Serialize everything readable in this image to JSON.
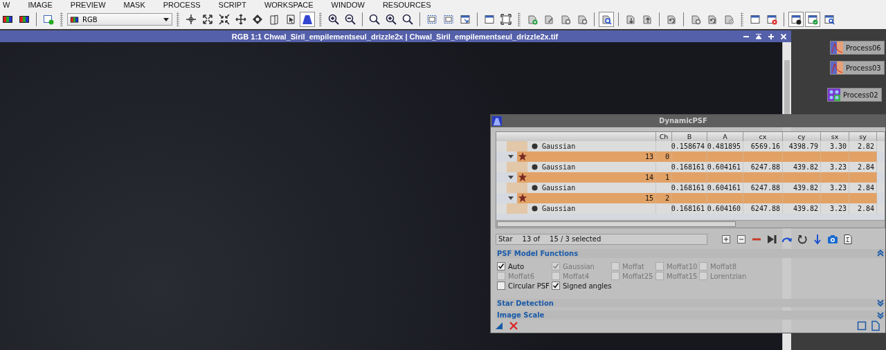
{
  "menu": [
    "W",
    "IMAGE",
    "PREVIEW",
    "MASK",
    "PROCESS",
    "SCRIPT",
    "WORKSPACE",
    "WINDOW",
    "RESOURCES"
  ],
  "toolbar": [
    {
      "kind": "channels",
      "selected": false
    },
    {
      "kind": "channels",
      "selected": false
    },
    {
      "kind": "separator"
    },
    {
      "kind": "new-window",
      "selected": false
    },
    {
      "kind": "grip"
    },
    {
      "kind": "combo",
      "value": "RGB"
    },
    {
      "kind": "grip"
    },
    {
      "kind": "crosshair",
      "selected": false
    },
    {
      "kind": "expand",
      "selected": false
    },
    {
      "kind": "shrink",
      "selected": false
    },
    {
      "kind": "move",
      "selected": false
    },
    {
      "kind": "diamond",
      "selected": false
    },
    {
      "kind": "page",
      "selected": false
    },
    {
      "kind": "page-pointer",
      "selected": false
    },
    {
      "kind": "curve",
      "selected": true
    },
    {
      "kind": "grip"
    },
    {
      "kind": "zoom-in",
      "selected": false
    },
    {
      "kind": "zoom-out",
      "selected": false
    },
    {
      "kind": "separator"
    },
    {
      "kind": "zoom",
      "selected": false
    },
    {
      "kind": "zoom-in",
      "selected": false
    },
    {
      "kind": "zoom",
      "selected": false
    },
    {
      "kind": "separator"
    },
    {
      "kind": "select",
      "selected": false
    },
    {
      "kind": "select",
      "selected": false
    },
    {
      "kind": "window-arrow",
      "selected": false
    },
    {
      "kind": "separator"
    },
    {
      "kind": "window",
      "selected": false
    },
    {
      "kind": "frame",
      "selected": false
    },
    {
      "kind": "grip"
    },
    {
      "kind": "doc-plus",
      "selected": false
    },
    {
      "kind": "doc-edit",
      "selected": false
    },
    {
      "kind": "doc-gear",
      "selected": false
    },
    {
      "kind": "doc-gear",
      "selected": false
    },
    {
      "kind": "separator"
    },
    {
      "kind": "doc-search",
      "selected": true
    },
    {
      "kind": "separator"
    },
    {
      "kind": "doc-down",
      "selected": false
    },
    {
      "kind": "doc-up",
      "selected": false
    },
    {
      "kind": "separator"
    },
    {
      "kind": "doc-undo",
      "selected": false
    },
    {
      "kind": "separator"
    },
    {
      "kind": "doc-gear",
      "selected": false
    },
    {
      "kind": "doc-undo",
      "selected": false
    },
    {
      "kind": "doc-cross",
      "selected": false
    },
    {
      "kind": "grip"
    },
    {
      "kind": "window",
      "selected": false
    },
    {
      "kind": "window-close",
      "selected": false
    },
    {
      "kind": "separator"
    },
    {
      "kind": "window-dark",
      "selected": true
    },
    {
      "kind": "window-check",
      "selected": true
    },
    {
      "kind": "window-search",
      "selected": false
    }
  ],
  "image_window": {
    "title": "RGB 1:1 Chwal_Siril_empilementseul_drizzle2x | Chwal_Siril_empilementseul_drizzle2x.tif"
  },
  "process_icons": [
    {
      "label": "Process06",
      "kind": "chart"
    },
    {
      "label": "Process03",
      "kind": "chart"
    },
    {
      "label": "Process02",
      "kind": "dots"
    }
  ],
  "dynamic_psf": {
    "title": "DynamicPSF",
    "columns": [
      "Ch",
      "B",
      "A",
      "cx",
      "cy",
      "sx",
      "sy"
    ],
    "rows": [
      {
        "kind": "function",
        "name": "Gaussian",
        "values": [
          "0.158674",
          "0.481895",
          "6569.16",
          "4398.79",
          "3.30",
          "2.82"
        ]
      },
      {
        "kind": "star",
        "number": "13",
        "channel": "0",
        "expanded": true,
        "selected": true
      },
      {
        "kind": "function",
        "name": "Gaussian",
        "values": [
          "0.168161",
          "0.604161",
          "6247.88",
          "439.82",
          "3.23",
          "2.84"
        ]
      },
      {
        "kind": "star",
        "number": "14",
        "channel": "1",
        "expanded": true,
        "selected": true
      },
      {
        "kind": "function",
        "name": "Gaussian",
        "values": [
          "0.168161",
          "0.604161",
          "6247.88",
          "439.82",
          "3.23",
          "2.84"
        ]
      },
      {
        "kind": "star",
        "number": "15",
        "channel": "2",
        "expanded": true,
        "selected": true
      },
      {
        "kind": "function",
        "name": "Gaussian",
        "values": [
          "0.168161",
          "0.604160",
          "6247.88",
          "439.82",
          "3.23",
          "2.84"
        ]
      }
    ],
    "status": {
      "label": "Star",
      "current": "13 of",
      "total": "15 / 3 selected"
    },
    "actions": [
      {
        "kind": "expand-all"
      },
      {
        "kind": "collapse-all"
      },
      {
        "kind": "remove"
      },
      {
        "kind": "last"
      },
      {
        "kind": "redo"
      },
      {
        "kind": "reset"
      },
      {
        "kind": "sort"
      },
      {
        "kind": "camera"
      },
      {
        "kind": "sum-doc"
      }
    ],
    "sections": [
      {
        "title": "PSF Model Functions",
        "expanded": true,
        "checkboxes": [
          {
            "label": "Auto",
            "checked": true,
            "disabled": false
          },
          {
            "label": "Gaussian",
            "checked": true,
            "disabled": true
          },
          {
            "label": "Moffat",
            "checked": false,
            "disabled": true
          },
          {
            "label": "Moffat10",
            "checked": false,
            "disabled": true
          },
          {
            "label": "Moffat8",
            "checked": false,
            "disabled": true
          },
          {
            "label": "Moffat6",
            "checked": false,
            "disabled": true
          },
          {
            "label": "Moffat4",
            "checked": false,
            "disabled": true
          },
          {
            "label": "Moffat25",
            "checked": false,
            "disabled": true
          },
          {
            "label": "Moffat15",
            "checked": false,
            "disabled": true
          },
          {
            "label": "Lorentzian",
            "checked": false,
            "disabled": true
          },
          {
            "label": "Circular PSF",
            "checked": false,
            "disabled": false
          },
          {
            "label": "Signed angles",
            "checked": true,
            "disabled": false
          }
        ]
      },
      {
        "title": "Star Detection",
        "expanded": false
      },
      {
        "title": "Image Scale",
        "expanded": false
      }
    ],
    "footer_left": [
      {
        "kind": "new-instance"
      },
      {
        "kind": "cancel"
      }
    ],
    "footer_right": [
      {
        "kind": "square"
      },
      {
        "kind": "document"
      }
    ]
  }
}
